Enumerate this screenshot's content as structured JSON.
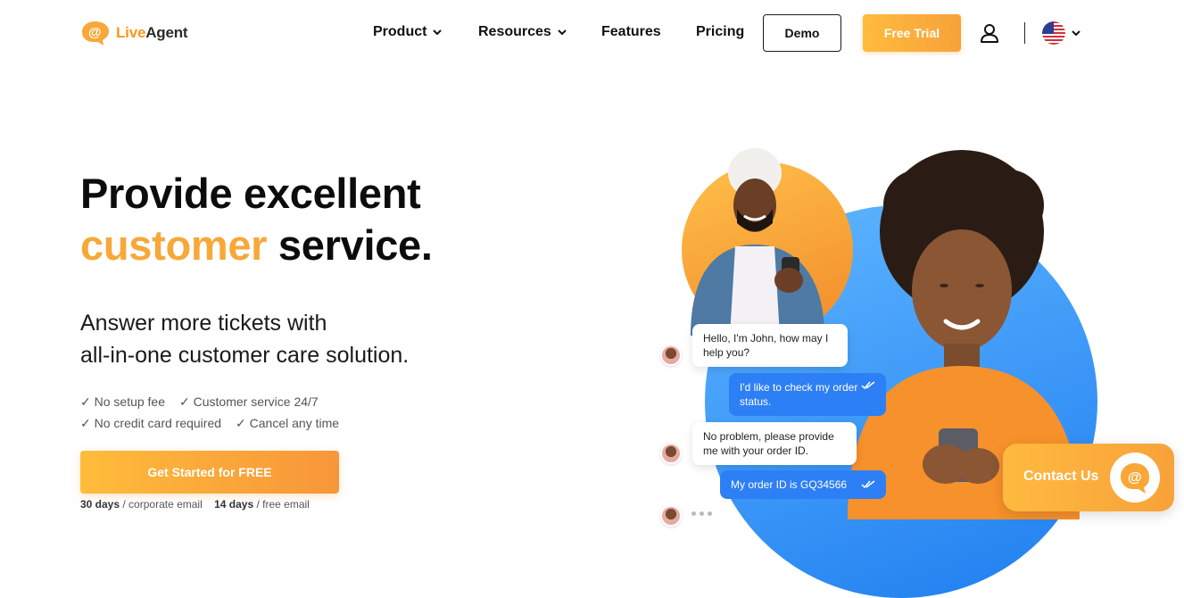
{
  "header": {
    "logo": {
      "part1": "Live",
      "part2": "Agent"
    },
    "nav": [
      {
        "label": "Product"
      },
      {
        "label": "Resources"
      },
      {
        "label": "Features"
      },
      {
        "label": "Pricing"
      }
    ],
    "demo_label": "Demo",
    "trial_label": "Free Trial"
  },
  "hero": {
    "title_line1": "Provide excellent",
    "title_accent": "customer",
    "title_end": " service.",
    "subtitle_line1": "Answer more tickets with",
    "subtitle_line2": "all-in-one customer care solution.",
    "checks": [
      "✓ No setup fee",
      "✓ Customer service 24/7",
      "✓ No credit card required",
      "✓ Cancel any time"
    ],
    "cta_label": "Get Started for FREE",
    "note_days1": "30 days",
    "note_text1": " / corporate email",
    "note_days2": "14 days",
    "note_text2": " / free email"
  },
  "chat": {
    "msg1": "Hello, I'm John, how may I help you?",
    "msg2": "I'd like to check my order status.",
    "msg3": "No problem, please provide me with your order ID.",
    "msg4": "My order ID is GQ34566"
  },
  "contact": {
    "label": "Contact Us"
  },
  "colors": {
    "accent": "#f7a839",
    "chat_blue": "#2d7ff5"
  }
}
